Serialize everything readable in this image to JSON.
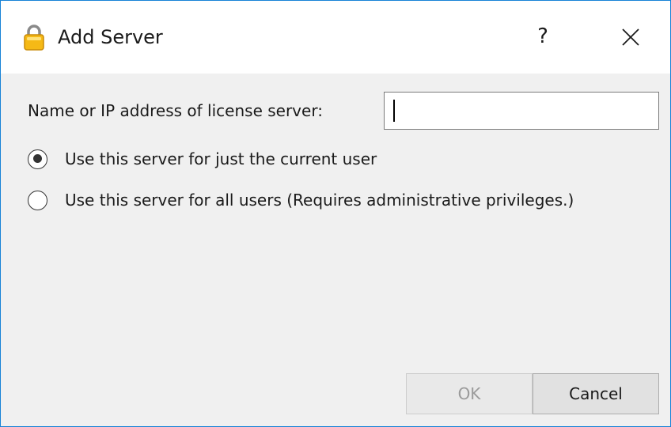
{
  "window": {
    "title": "Add Server",
    "help_label": "?",
    "icon": "padlock-icon",
    "accent_color": "#1783d7"
  },
  "form": {
    "server_label": "Name or IP address of license server:",
    "server_value": "",
    "radios": [
      {
        "label": "Use this server for just the current user",
        "checked": true
      },
      {
        "label": "Use this server for all users (Requires administrative privileges.)",
        "checked": false
      }
    ]
  },
  "buttons": {
    "ok_label": "OK",
    "ok_enabled": false,
    "cancel_label": "Cancel"
  }
}
